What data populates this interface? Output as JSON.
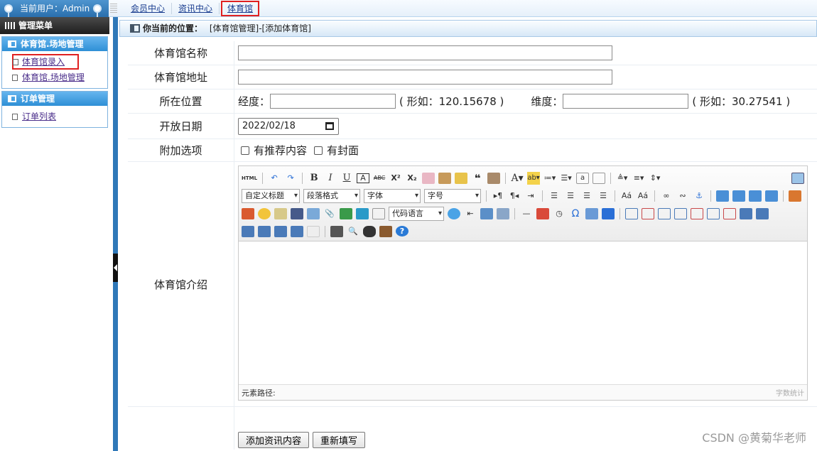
{
  "header": {
    "user_label": "当前用户：Admin",
    "nav": [
      "会员中心",
      "资讯中心",
      "体育馆"
    ]
  },
  "sidebar": {
    "title": "管理菜单",
    "groups": [
      {
        "title": "体育馆.场地管理",
        "items": [
          "体育馆录入",
          "体育馆.场地管理"
        ]
      },
      {
        "title": "订单管理",
        "items": [
          "订单列表"
        ]
      }
    ]
  },
  "breadcrumb": {
    "prefix": "你当前的位置：",
    "path": "[体育馆管理]-[添加体育馆]"
  },
  "form": {
    "name_label": "体育馆名称",
    "name_value": "",
    "address_label": "体育馆地址",
    "address_value": "",
    "location_label": "所在位置",
    "longitude_label": "经度：",
    "longitude_hint": "( 形如：120.15678 )",
    "latitude_label": "维度：",
    "latitude_hint": "( 形如：30.27541 )",
    "date_label": "开放日期",
    "date_value": "2022/02/18",
    "options_label": "附加选项",
    "option_recommend": "有推荐内容",
    "option_cover": "有封面",
    "intro_label": "体育馆介绍",
    "submit_button": "添加资讯内容",
    "reset_button": "重新填写"
  },
  "editor": {
    "html_btn": "HTML",
    "combos": [
      "自定义标题",
      "段落格式",
      "字体",
      "字号",
      "代码语言"
    ],
    "element_path": "元素路径:",
    "word_count": "字数统计"
  },
  "watermark": "CSDN @黄菊华老师",
  "colors": {
    "sidebar_head": "#2e8fd6",
    "selected_outline": "#e02020",
    "divider": "#2f78b8"
  }
}
